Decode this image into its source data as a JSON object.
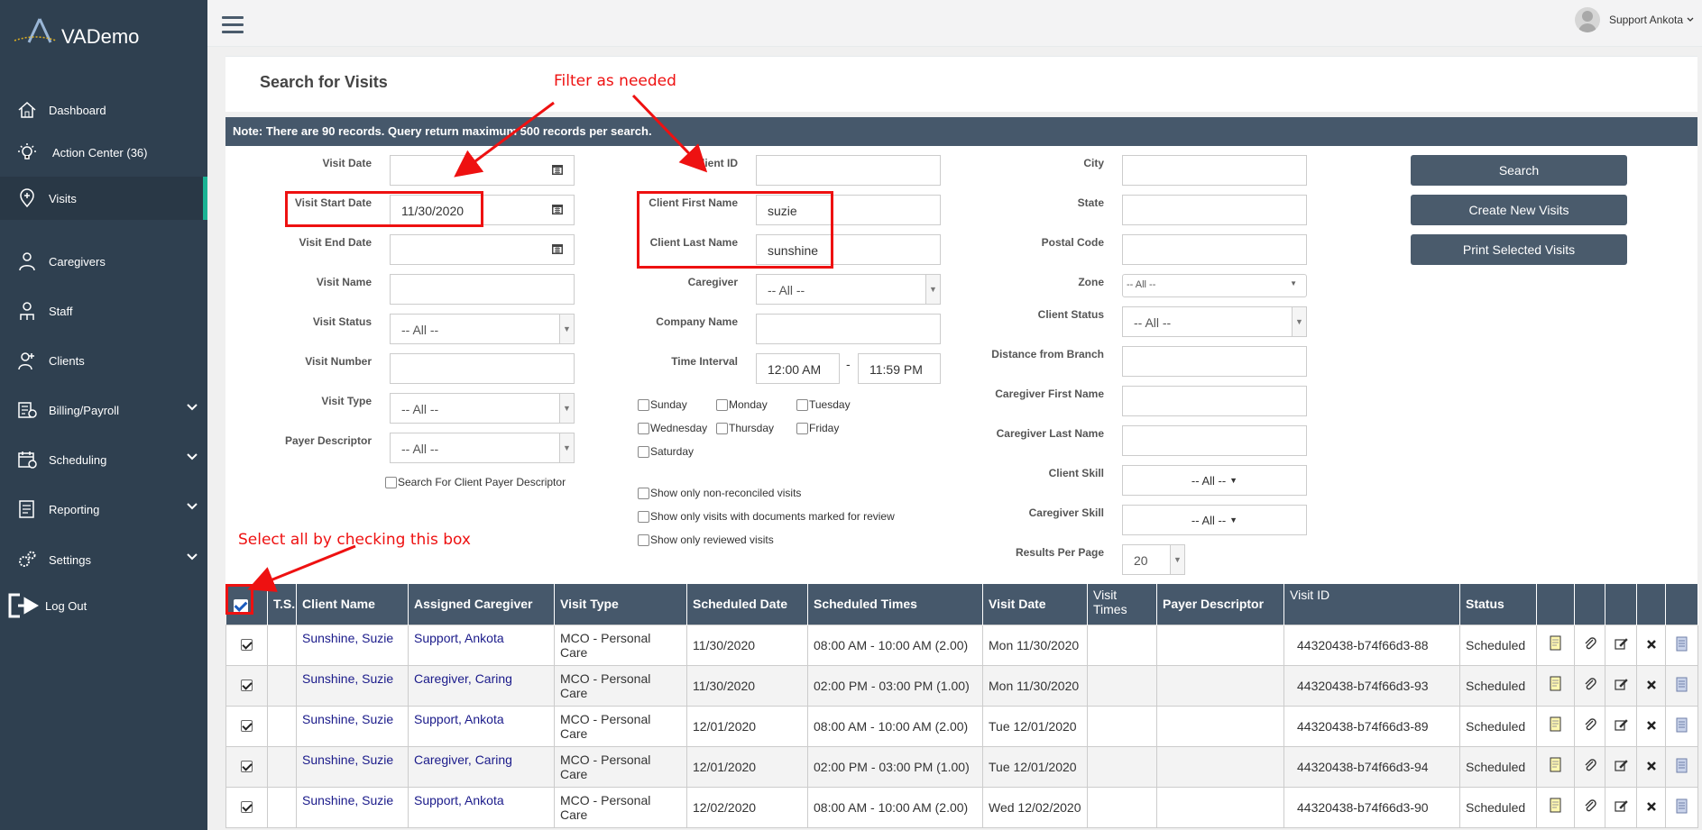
{
  "app": {
    "name": "VADemo"
  },
  "sidebar": {
    "items": [
      {
        "label": "Dashboard",
        "icon": "home-icon"
      },
      {
        "label": "Action Center (36)",
        "icon": "lightbulb-icon"
      },
      {
        "label": "Visits",
        "icon": "map-pin-plus-icon",
        "active": true
      },
      {
        "label": "Caregivers",
        "icon": "caregiver-icon"
      },
      {
        "label": "Staff",
        "icon": "staff-icon"
      },
      {
        "label": "Clients",
        "icon": "client-icon"
      },
      {
        "label": "Billing/Payroll",
        "icon": "billing-icon"
      },
      {
        "label": "Scheduling",
        "icon": "calendar-icon"
      },
      {
        "label": "Reporting",
        "icon": "report-icon"
      },
      {
        "label": "Settings",
        "icon": "gears-icon"
      },
      {
        "label": "Log Out",
        "icon": "logout-icon"
      }
    ]
  },
  "header": {
    "user_name": "Support Ankota"
  },
  "page": {
    "title": "Search for Visits",
    "note": "Note: There are 90 records. Query return maximum 500 records per search."
  },
  "form": {
    "col1": {
      "visit_date_label": "Visit Date",
      "visit_start_date_label": "Visit Start Date",
      "visit_start_date_value": "11/30/2020",
      "visit_end_date_label": "Visit End Date",
      "visit_name_label": "Visit Name",
      "visit_status_label": "Visit Status",
      "visit_status_value": "-- All --",
      "visit_number_label": "Visit Number",
      "visit_type_label": "Visit Type",
      "visit_type_value": "-- All --",
      "payer_descriptor_label": "Payer Descriptor",
      "payer_descriptor_value": "-- All --",
      "search_client_payer_label": "Search For Client Payer Descriptor"
    },
    "col2": {
      "client_id_label": "Client ID",
      "client_first_name_label": "Client First Name",
      "client_first_name_value": "suzie",
      "client_last_name_label": "Client Last Name",
      "client_last_name_value": "sunshine",
      "caregiver_label": "Caregiver",
      "caregiver_value": "-- All --",
      "company_name_label": "Company Name",
      "time_interval_label": "Time Interval",
      "time_from": "12:00 AM",
      "time_sep": "-",
      "time_to": "11:59 PM",
      "days": [
        "Sunday",
        "Monday",
        "Tuesday",
        "Wednesday",
        "Thursday",
        "Friday",
        "Saturday"
      ],
      "opt_non_reconciled": "Show only non-reconciled visits",
      "opt_documents_review": "Show only visits with documents marked for review",
      "opt_reviewed": "Show only reviewed visits"
    },
    "col3": {
      "city_label": "City",
      "state_label": "State",
      "postal_code_label": "Postal Code",
      "zone_label": "Zone",
      "zone_value": "-- All --",
      "client_status_label": "Client Status",
      "client_status_value": "-- All --",
      "distance_label": "Distance from Branch",
      "caregiver_first_name_label": "Caregiver First Name",
      "caregiver_last_name_label": "Caregiver Last Name",
      "client_skill_label": "Client Skill",
      "client_skill_value": "-- All --",
      "caregiver_skill_label": "Caregiver Skill",
      "caregiver_skill_value": "-- All --",
      "results_per_page_label": "Results Per Page",
      "results_per_page_value": "20"
    },
    "buttons": {
      "search": "Search",
      "create_new": "Create New Visits",
      "print_selected": "Print Selected Visits"
    }
  },
  "table": {
    "headers": [
      "T.S.",
      "Client Name",
      "Assigned Caregiver",
      "Visit Type",
      "Scheduled Date",
      "Scheduled Times",
      "Visit Date",
      "Visit Times",
      "Payer Descriptor",
      "Visit ID",
      "Status"
    ],
    "rows": [
      {
        "client": "Sunshine, Suzie",
        "caregiver": "Support, Ankota",
        "type": "MCO - Personal Care",
        "sched_date": "11/30/2020",
        "sched_times": "08:00 AM - 10:00 AM (2.00)",
        "visit_date": "Mon 11/30/2020",
        "visit_times": "",
        "payer": "",
        "visit_id": "44320438-b74f66d3-88",
        "status": "Scheduled"
      },
      {
        "client": "Sunshine, Suzie",
        "caregiver": "Caregiver, Caring",
        "type": "MCO - Personal Care",
        "sched_date": "11/30/2020",
        "sched_times": "02:00 PM - 03:00 PM (1.00)",
        "visit_date": "Mon 11/30/2020",
        "visit_times": "",
        "payer": "",
        "visit_id": "44320438-b74f66d3-93",
        "status": "Scheduled"
      },
      {
        "client": "Sunshine, Suzie",
        "caregiver": "Support, Ankota",
        "type": "MCO - Personal Care",
        "sched_date": "12/01/2020",
        "sched_times": "08:00 AM - 10:00 AM (2.00)",
        "visit_date": "Tue 12/01/2020",
        "visit_times": "",
        "payer": "",
        "visit_id": "44320438-b74f66d3-89",
        "status": "Scheduled"
      },
      {
        "client": "Sunshine, Suzie",
        "caregiver": "Caregiver, Caring",
        "type": "MCO - Personal Care",
        "sched_date": "12/01/2020",
        "sched_times": "02:00 PM - 03:00 PM (1.00)",
        "visit_date": "Tue 12/01/2020",
        "visit_times": "",
        "payer": "",
        "visit_id": "44320438-b74f66d3-94",
        "status": "Scheduled"
      },
      {
        "client": "Sunshine, Suzie",
        "caregiver": "Support, Ankota",
        "type": "MCO - Personal Care",
        "sched_date": "12/02/2020",
        "sched_times": "08:00 AM - 10:00 AM (2.00)",
        "visit_date": "Wed 12/02/2020",
        "visit_times": "",
        "payer": "",
        "visit_id": "44320438-b74f66d3-90",
        "status": "Scheduled"
      }
    ]
  },
  "annotations": {
    "filter": "Filter as needed",
    "select_all": "Select all by checking this box"
  },
  "colors": {
    "sidebar": "#2f4050",
    "header_bar": "#46586b",
    "accent": "#1ab394",
    "annotation": "#ee1111"
  }
}
